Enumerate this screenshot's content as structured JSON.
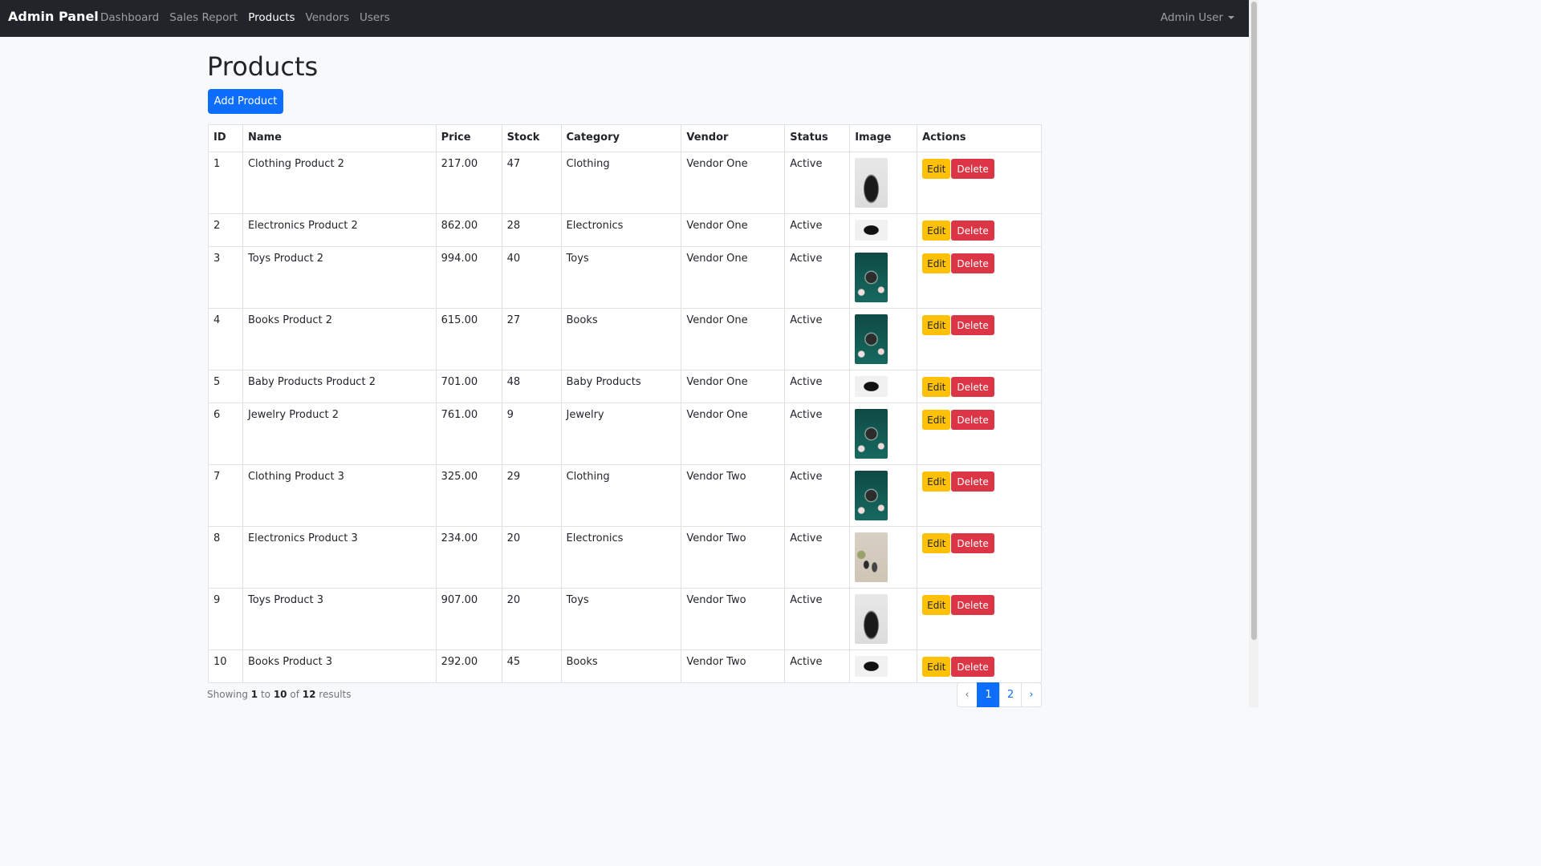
{
  "navbar": {
    "brand": "Admin Panel",
    "links": [
      {
        "label": "Dashboard",
        "active": false
      },
      {
        "label": "Sales Report",
        "active": false
      },
      {
        "label": "Products",
        "active": true
      },
      {
        "label": "Vendors",
        "active": false
      },
      {
        "label": "Users",
        "active": false
      }
    ],
    "user": "Admin User"
  },
  "page": {
    "title": "Products",
    "add_button": "Add Product"
  },
  "table": {
    "headers": [
      "ID",
      "Name",
      "Price",
      "Stock",
      "Category",
      "Vendor",
      "Status",
      "Image",
      "Actions"
    ],
    "edit_label": "Edit",
    "delete_label": "Delete",
    "rows": [
      {
        "id": "1",
        "name": "Clothing Product 2",
        "price": "217.00",
        "stock": "47",
        "category": "Clothing",
        "vendor": "Vendor One",
        "status": "Active",
        "image": "bag"
      },
      {
        "id": "2",
        "name": "Electronics Product 2",
        "price": "862.00",
        "stock": "28",
        "category": "Electronics",
        "vendor": "Vendor One",
        "status": "Active",
        "image": "camera"
      },
      {
        "id": "3",
        "name": "Toys Product 2",
        "price": "994.00",
        "stock": "40",
        "category": "Toys",
        "vendor": "Vendor One",
        "status": "Active",
        "image": "watch"
      },
      {
        "id": "4",
        "name": "Books Product 2",
        "price": "615.00",
        "stock": "27",
        "category": "Books",
        "vendor": "Vendor One",
        "status": "Active",
        "image": "watch"
      },
      {
        "id": "5",
        "name": "Baby Products Product 2",
        "price": "701.00",
        "stock": "48",
        "category": "Baby Products",
        "vendor": "Vendor One",
        "status": "Active",
        "image": "camera"
      },
      {
        "id": "6",
        "name": "Jewelry Product 2",
        "price": "761.00",
        "stock": "9",
        "category": "Jewelry",
        "vendor": "Vendor One",
        "status": "Active",
        "image": "watch"
      },
      {
        "id": "7",
        "name": "Clothing Product 3",
        "price": "325.00",
        "stock": "29",
        "category": "Clothing",
        "vendor": "Vendor Two",
        "status": "Active",
        "image": "watch"
      },
      {
        "id": "8",
        "name": "Electronics Product 3",
        "price": "234.00",
        "stock": "20",
        "category": "Electronics",
        "vendor": "Vendor Two",
        "status": "Active",
        "image": "bottles"
      },
      {
        "id": "9",
        "name": "Toys Product 3",
        "price": "907.00",
        "stock": "20",
        "category": "Toys",
        "vendor": "Vendor Two",
        "status": "Active",
        "image": "bag"
      },
      {
        "id": "10",
        "name": "Books Product 3",
        "price": "292.00",
        "stock": "45",
        "category": "Books",
        "vendor": "Vendor Two",
        "status": "Active",
        "image": "camera"
      }
    ]
  },
  "footer": {
    "showing_prefix": "Showing",
    "from": "1",
    "to_word": "to",
    "to": "10",
    "of_word": "of",
    "total": "12",
    "results_word": "results"
  },
  "pagination": {
    "prev": "‹",
    "pages": [
      "1",
      "2"
    ],
    "current": "1",
    "next": "›"
  }
}
